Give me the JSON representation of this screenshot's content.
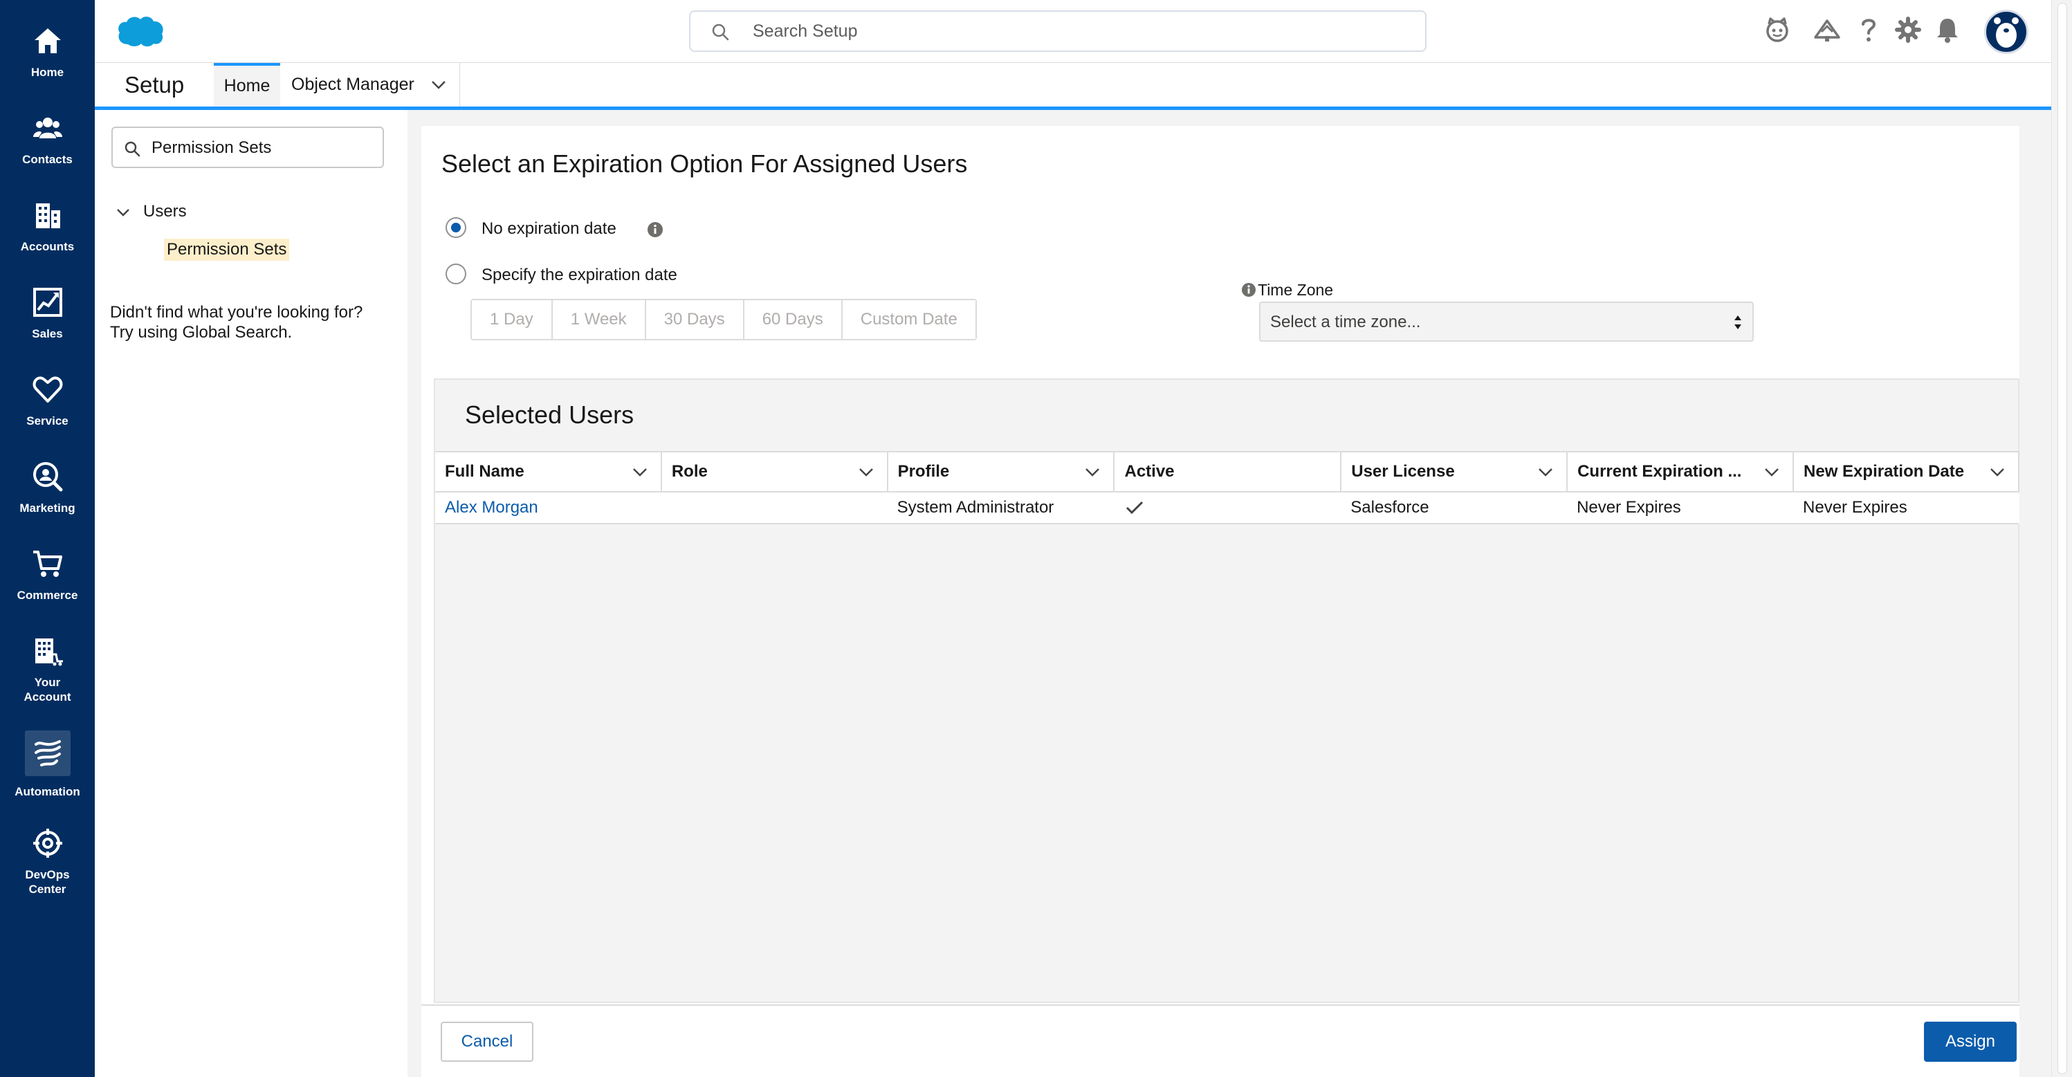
{
  "rail": {
    "items": [
      {
        "label": "Home",
        "icon": "home-icon"
      },
      {
        "label": "Contacts",
        "icon": "contacts-icon"
      },
      {
        "label": "Accounts",
        "icon": "accounts-icon"
      },
      {
        "label": "Sales",
        "icon": "sales-chart-icon"
      },
      {
        "label": "Service",
        "icon": "heart-icon"
      },
      {
        "label": "Marketing",
        "icon": "marketing-icon"
      },
      {
        "label": "Commerce",
        "icon": "cart-icon"
      },
      {
        "label": "Your Account",
        "icon": "your-account-icon"
      },
      {
        "label": "Automation",
        "icon": "automation-icon"
      },
      {
        "label": "DevOps Center",
        "icon": "devops-icon"
      }
    ]
  },
  "header": {
    "search_placeholder": "Search Setup",
    "icons": [
      "astro-icon",
      "trailhead-icon",
      "help-icon",
      "gear-icon",
      "bell-icon",
      "avatar"
    ]
  },
  "context_bar": {
    "app_title": "Setup",
    "tabs": [
      {
        "label": "Home",
        "active": true
      },
      {
        "label": "Object Manager",
        "active": false
      }
    ]
  },
  "setup_tree": {
    "quick_find_value": "Permission Sets",
    "group_label": "Users",
    "item_label": "Permission Sets",
    "not_found_line1": "Didn't find what you're looking for?",
    "not_found_line2": "Try using Global Search."
  },
  "expiration": {
    "title": "Select an Expiration Option For Assigned Users",
    "options": [
      {
        "label": "No expiration date",
        "checked": true
      },
      {
        "label": "Specify the expiration date",
        "checked": false
      }
    ],
    "durations": [
      "1 Day",
      "1 Week",
      "30 Days",
      "60 Days",
      "Custom Date"
    ],
    "time_zone_label": "Time Zone",
    "time_zone_placeholder": "Select a time zone..."
  },
  "selected_users": {
    "title": "Selected Users",
    "columns": [
      "Full Name",
      "Role",
      "Profile",
      "Active",
      "User License",
      "Current Expiration ...",
      "New Expiration Date"
    ],
    "rows": [
      {
        "full_name": "Alex Morgan",
        "role": "",
        "profile": "System Administrator",
        "active": true,
        "user_license": "Salesforce",
        "current_expiration": "Never Expires",
        "new_expiration": "Never Expires"
      }
    ]
  },
  "footer": {
    "cancel_label": "Cancel",
    "assign_label": "Assign"
  },
  "colors": {
    "rail_bg": "#032d60",
    "brand_blue": "#0b5cab",
    "accent_blue": "#1b96ff",
    "highlight": "#fcefca"
  }
}
